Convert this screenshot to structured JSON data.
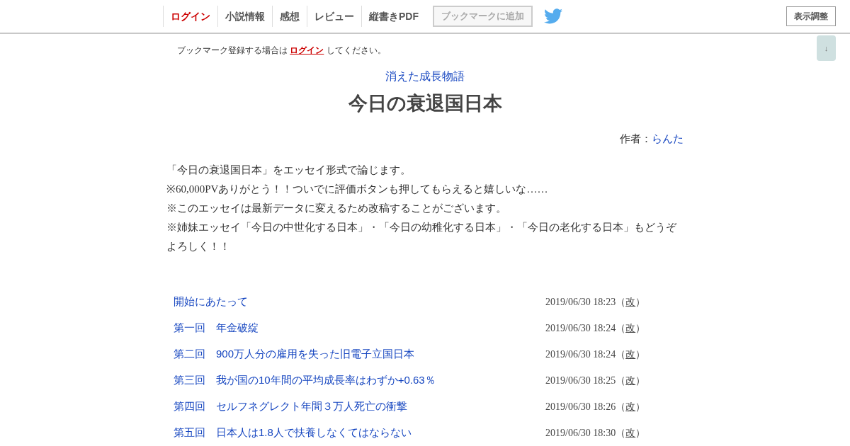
{
  "nav": {
    "items": [
      {
        "label": "ログイン",
        "selected": true
      },
      {
        "label": "小説情報",
        "selected": false
      },
      {
        "label": "感想",
        "selected": false
      },
      {
        "label": "レビュー",
        "selected": false
      },
      {
        "label": "縦書きPDF",
        "selected": false
      }
    ],
    "bookmark_button": {
      "label": "ブックマークに追加",
      "disabled": true
    },
    "display_button": "表示調整"
  },
  "scroll_down_button": "↓",
  "login_notice": {
    "before": "ブックマーク登録する場合は",
    "link": "ログイン",
    "after": "してください。"
  },
  "series_title": "消えた成長物語",
  "title": "今日の衰退国日本",
  "author": {
    "label": "作者：",
    "name": "らんた"
  },
  "synopsis": [
    "「今日の衰退国日本」をエッセイ形式で論じます。",
    "※60,000PVありがとう！！ついでに評価ボタンも押してもらえると嬉しいな……",
    "※このエッセイは最新データに変えるため改稿することがございます。",
    "※姉妹エッセイ「今日の中世化する日本」・「今日の幼稚化する日本」・「今日の老化する日本」もどうぞよろしく！！"
  ],
  "chapters": [
    {
      "title": "開始にあたって",
      "date": "2019/06/30 18:23",
      "open": "（",
      "revision": "改",
      "close": "）"
    },
    {
      "title": "第一回　年金破綻",
      "date": "2019/06/30 18:24",
      "open": "（",
      "revision": "改",
      "close": "）"
    },
    {
      "title": "第二回　900万人分の雇用を失った旧電子立国日本",
      "date": "2019/06/30 18:24",
      "open": "（",
      "revision": "改",
      "close": "）"
    },
    {
      "title": "第三回　我が国の10年間の平均成長率はわずか+0.63％",
      "date": "2019/06/30 18:25",
      "open": "（",
      "revision": "改",
      "close": "）"
    },
    {
      "title": "第四回　セルフネグレクト年間３万人死亡の衝撃",
      "date": "2019/06/30 18:26",
      "open": "（",
      "revision": "改",
      "close": "）"
    },
    {
      "title": "第五回　日本人は1.8人で扶養しなくてはならない",
      "date": "2019/06/30 18:30",
      "open": "（",
      "revision": "改",
      "close": "）"
    }
  ]
}
